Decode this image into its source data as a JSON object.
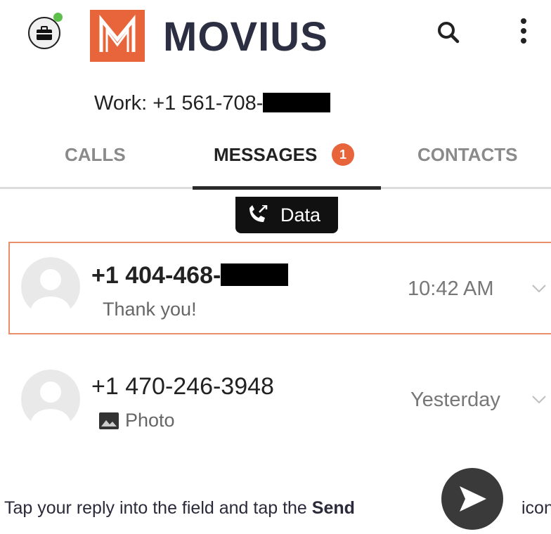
{
  "header": {
    "logo_text": "MOVIUS",
    "icons": [
      "briefcase-icon",
      "search-icon",
      "more-vertical-icon"
    ]
  },
  "work_line": {
    "label": "Work: +1 561-708-"
  },
  "tabs": [
    {
      "label": "CALLS",
      "selected": false
    },
    {
      "label": "MESSAGES",
      "selected": true,
      "badge": "1"
    },
    {
      "label": "CONTACTS",
      "selected": false
    }
  ],
  "data_chip": {
    "label": "Data",
    "icon": "wifi-call-icon"
  },
  "conversations": [
    {
      "number": "+1 404-468-",
      "preview": "Thank you!",
      "time": "10:42 AM",
      "highlighted": true
    },
    {
      "number": "+1 470-246-3948",
      "preview": "Photo",
      "preview_icon": "image-icon",
      "time": "Yesterday",
      "highlighted": false
    }
  ],
  "instruction": {
    "text_before": "Tap your reply into the field and tap the ",
    "bold": "Send",
    "text_after": "icon"
  },
  "colors": {
    "brand_orange": "#e8643a",
    "logo_dark": "#2c2f42",
    "highlight_border": "#e8906a",
    "presence_green": "#5cc04a"
  }
}
